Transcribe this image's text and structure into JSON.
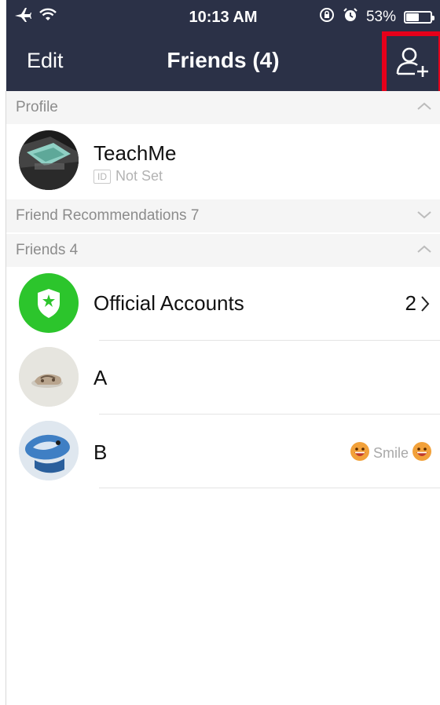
{
  "status_bar": {
    "time": "10:13 AM",
    "battery_percent_label": "53%",
    "battery_level": 0.53
  },
  "nav": {
    "edit_label": "Edit",
    "title": "Friends (4)",
    "add_friend_icon": "add-friend-icon"
  },
  "sections": {
    "profile": "Profile",
    "recommendations": "Friend Recommendations 7",
    "friends": "Friends 4"
  },
  "profile": {
    "name": "TeachMe",
    "id_badge": "ID",
    "id_status": "Not Set"
  },
  "friends": [
    {
      "name": "Official Accounts",
      "count": "2"
    },
    {
      "name": "A"
    },
    {
      "name": "B",
      "status_message": "Smile"
    }
  ],
  "colors": {
    "nav_background": "#2b3147",
    "highlight": "#e6001a",
    "official_green": "#2cc52c"
  }
}
